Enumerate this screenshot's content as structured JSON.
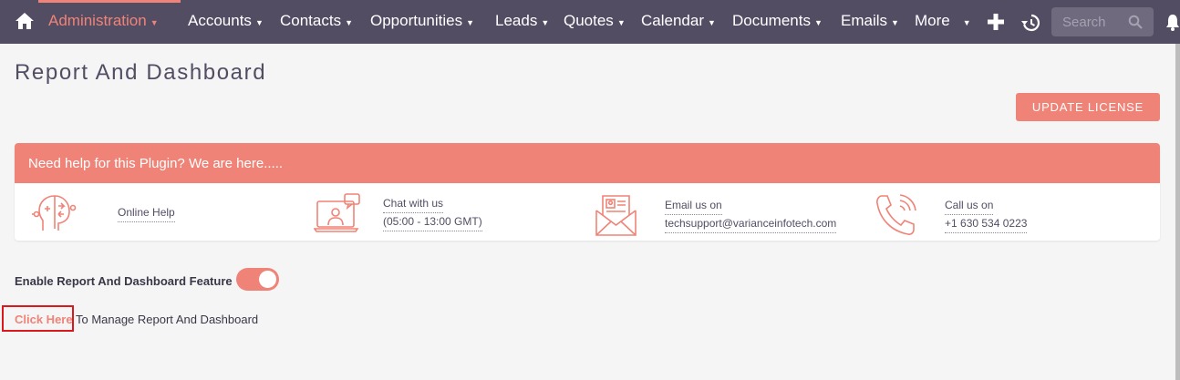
{
  "nav": {
    "items": [
      {
        "label": "Administration"
      },
      {
        "label": "Accounts"
      },
      {
        "label": "Contacts"
      },
      {
        "label": "Opportunities"
      },
      {
        "label": "Leads"
      },
      {
        "label": "Quotes"
      },
      {
        "label": "Calendar"
      },
      {
        "label": "Documents"
      },
      {
        "label": "Emails"
      },
      {
        "label": "More"
      }
    ],
    "search_placeholder": "Search"
  },
  "page": {
    "title": "Report And Dashboard",
    "update_button": "UPDATE LICENSE"
  },
  "help": {
    "header": "Need help for this Plugin? We are here.....",
    "online_help": "Online Help",
    "chat_label": "Chat with us",
    "chat_hours": "(05:00 - 13:00 GMT)",
    "email_label": "Email us on",
    "email_value": "techsupport@varianceinfotech.com",
    "call_label": "Call us on",
    "call_value": "+1 630 534 0223"
  },
  "feature": {
    "label": "Enable Report And Dashboard Feature",
    "enabled": true
  },
  "manage": {
    "link": "Click Here",
    "text": " To Manage Report And Dashboard"
  },
  "colors": {
    "nav_bg": "#534d64",
    "accent": "#f08377",
    "page_bg": "#f5f5f5"
  }
}
